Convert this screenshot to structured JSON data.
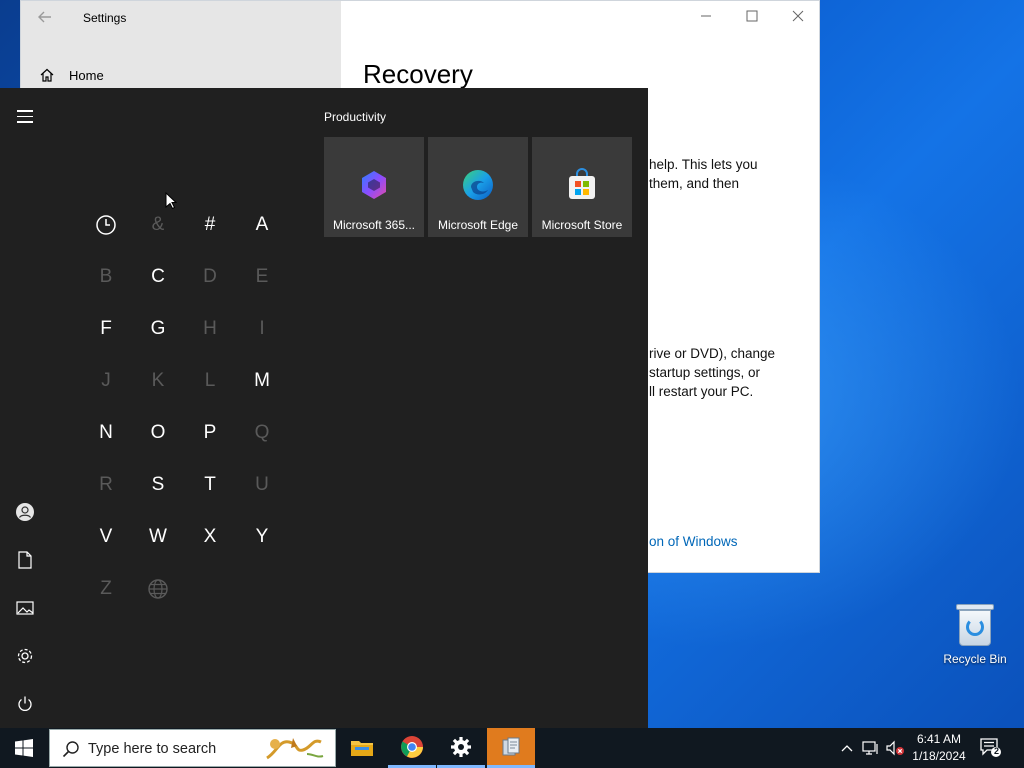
{
  "settings": {
    "title": "Settings",
    "nav_home": "Home",
    "heading": "Recovery",
    "para1_line1": "help. This lets you",
    "para1_line2": "them, and then",
    "para2_line1": "rive or DVD), change",
    "para2_line2": "startup settings, or",
    "para2_line3": "ll restart your PC.",
    "link": "on of Windows"
  },
  "start_menu": {
    "group_title": "Productivity",
    "jump_letters": [
      {
        "label": "&",
        "enabled": false
      },
      {
        "label": "#",
        "enabled": true
      },
      {
        "label": "A",
        "enabled": true
      },
      {
        "label": "B",
        "enabled": false
      },
      {
        "label": "C",
        "enabled": true
      },
      {
        "label": "D",
        "enabled": false
      },
      {
        "label": "E",
        "enabled": false
      },
      {
        "label": "F",
        "enabled": true
      },
      {
        "label": "G",
        "enabled": true
      },
      {
        "label": "H",
        "enabled": false
      },
      {
        "label": "I",
        "enabled": false
      },
      {
        "label": "J",
        "enabled": false
      },
      {
        "label": "K",
        "enabled": false
      },
      {
        "label": "L",
        "enabled": false
      },
      {
        "label": "M",
        "enabled": true
      },
      {
        "label": "N",
        "enabled": true
      },
      {
        "label": "O",
        "enabled": true
      },
      {
        "label": "P",
        "enabled": true
      },
      {
        "label": "Q",
        "enabled": false
      },
      {
        "label": "R",
        "enabled": false
      },
      {
        "label": "S",
        "enabled": true
      },
      {
        "label": "T",
        "enabled": true
      },
      {
        "label": "U",
        "enabled": false
      },
      {
        "label": "V",
        "enabled": true
      },
      {
        "label": "W",
        "enabled": true
      },
      {
        "label": "X",
        "enabled": true
      },
      {
        "label": "Y",
        "enabled": true
      },
      {
        "label": "Z",
        "enabled": false
      }
    ],
    "tiles": [
      {
        "label": "Microsoft 365...",
        "icon": "microsoft-365-icon"
      },
      {
        "label": "Microsoft Edge",
        "icon": "edge-icon"
      },
      {
        "label": "Microsoft Store",
        "icon": "store-icon"
      }
    ],
    "rail_icons": [
      "user-icon",
      "documents-icon",
      "pictures-icon",
      "settings-icon",
      "power-icon"
    ]
  },
  "taskbar": {
    "search_placeholder": "Type here to search",
    "apps": [
      "file-explorer-icon",
      "chrome-icon",
      "settings-icon",
      "app-icon"
    ],
    "clock_time": "6:41 AM",
    "clock_date": "1/18/2024",
    "notification_count": "2"
  },
  "desktop": {
    "recycle_bin_label": "Recycle Bin"
  },
  "colors": {
    "start_bg": "#202020",
    "tile_bg": "#3a3a3a",
    "link": "#0067b8",
    "taskbar": "#101820"
  }
}
